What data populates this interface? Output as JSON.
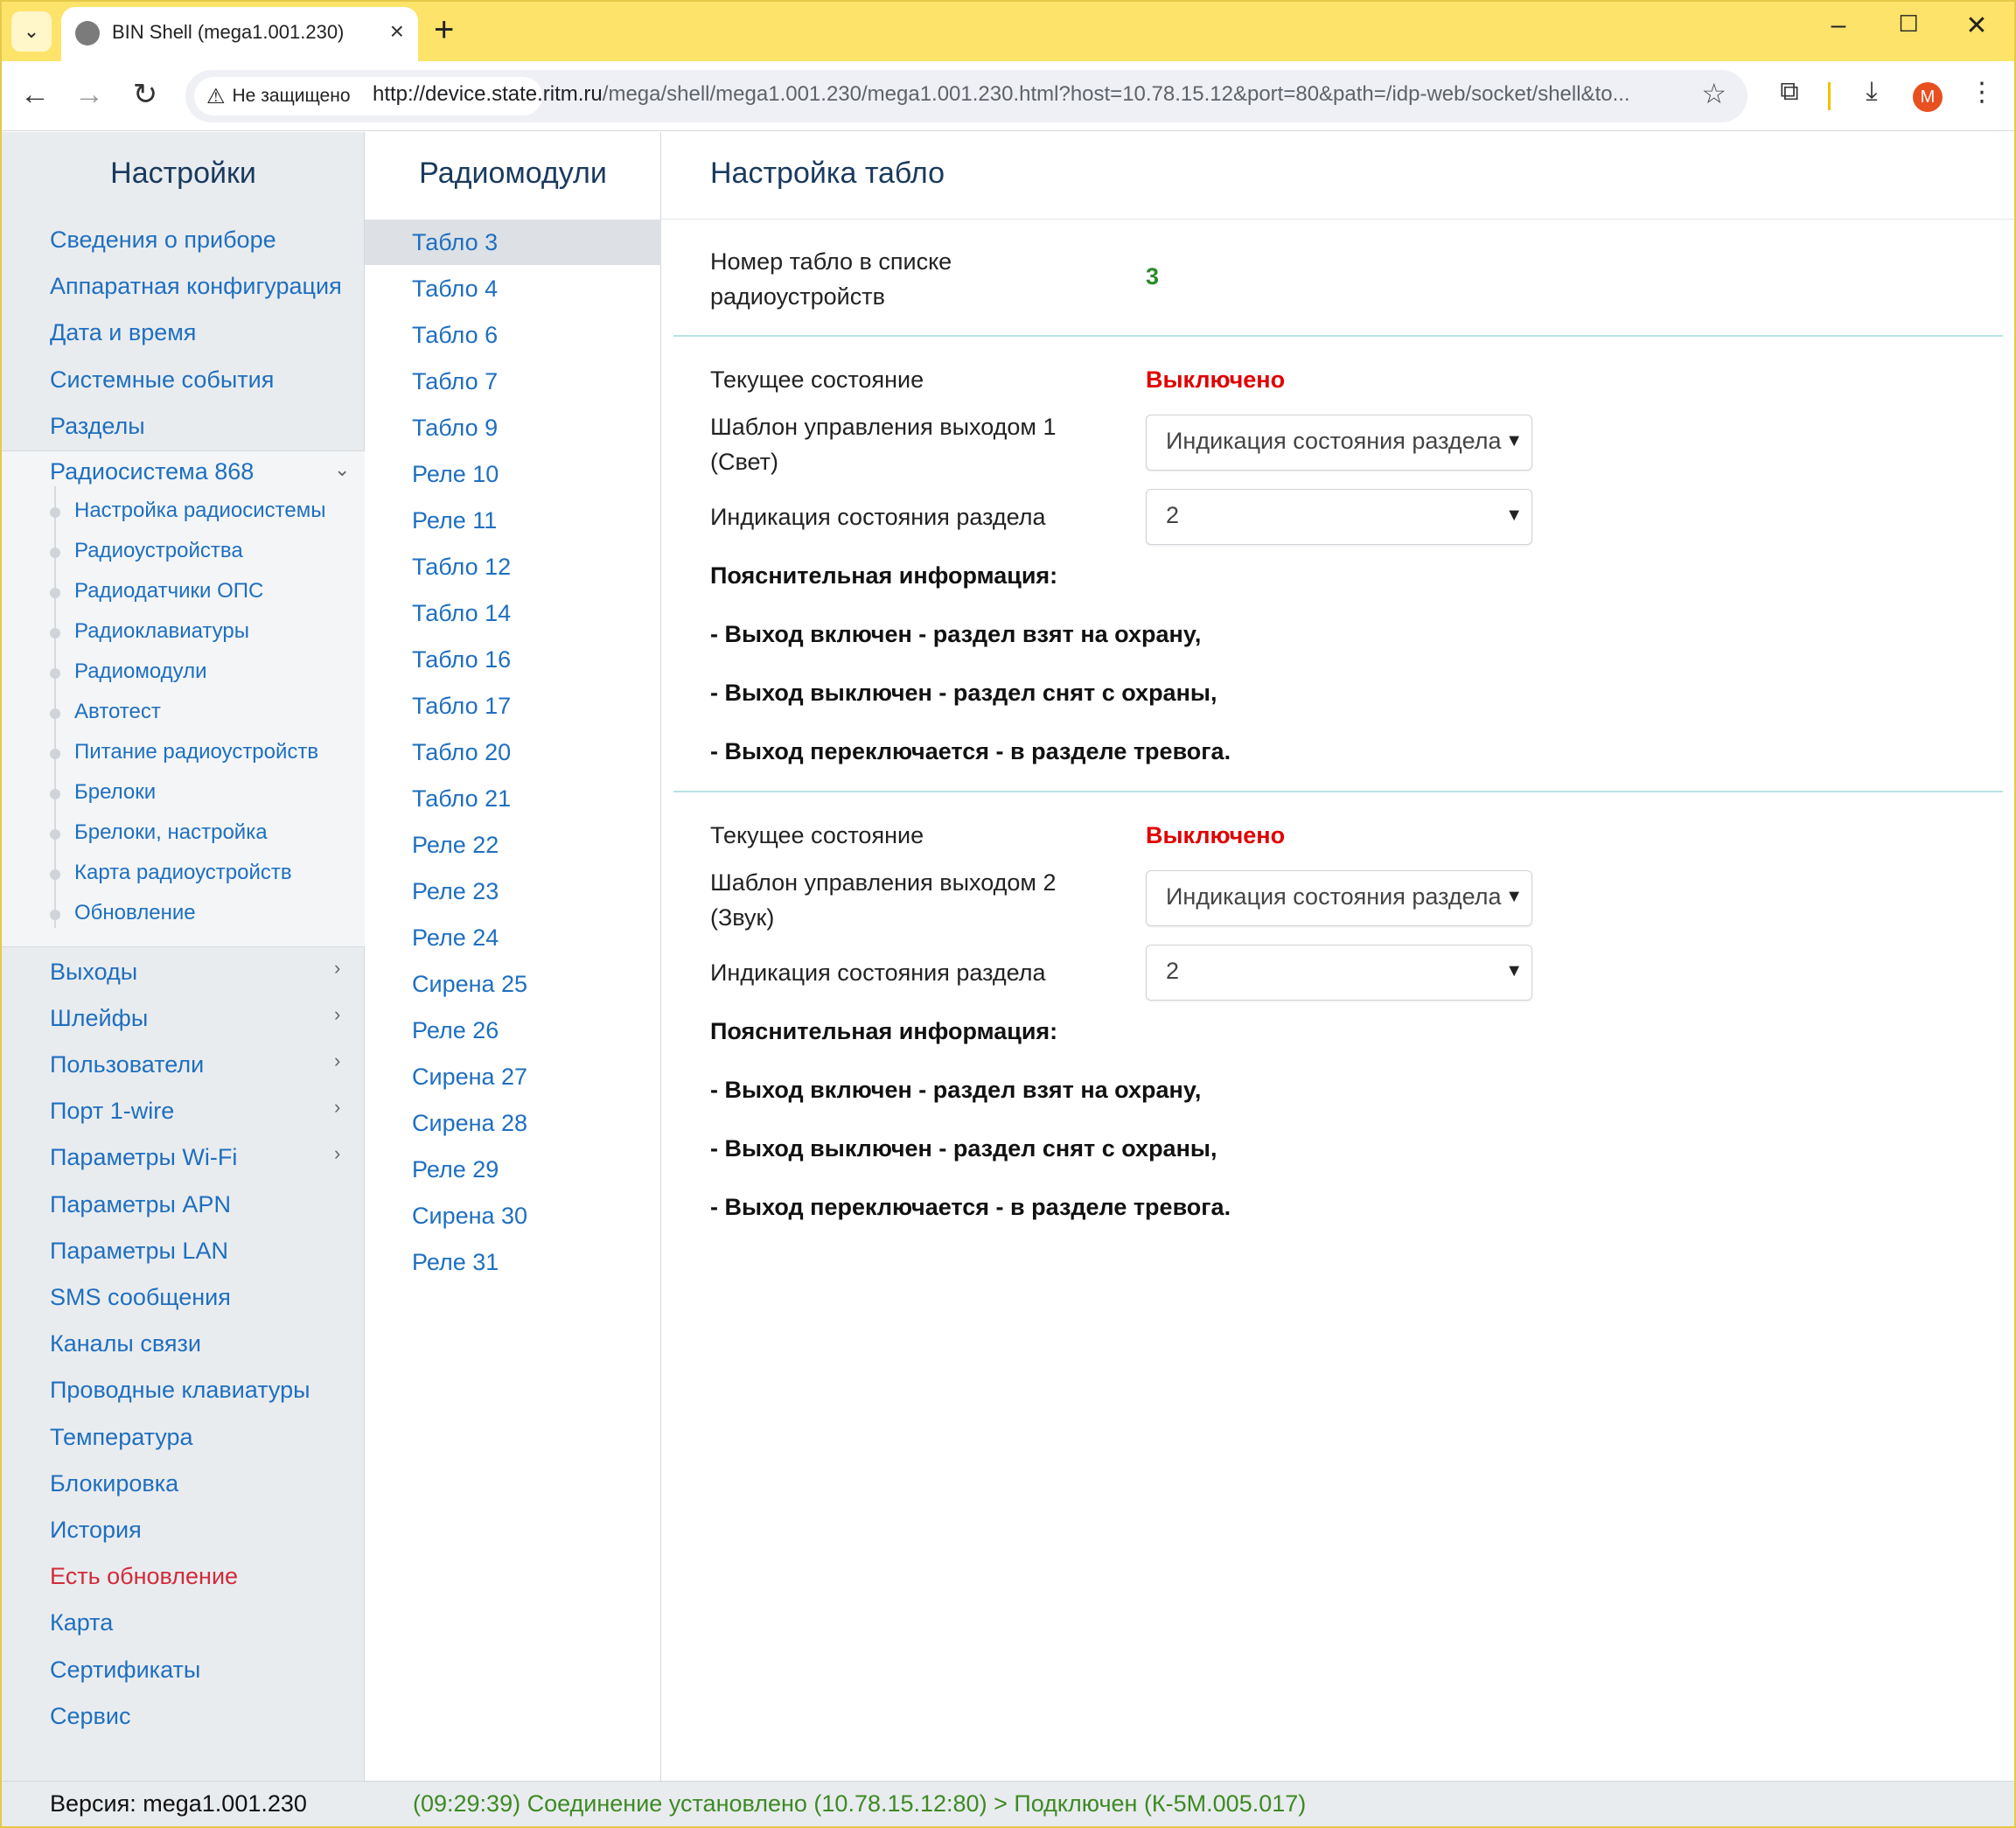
{
  "browser": {
    "tab_title": "BIN Shell (mega1.001.230)",
    "security_label": "Не защищено",
    "url_host": "http://device.state.ritm.ru",
    "url_rest": "/mega/shell/mega1.001.230/mega1.001.230.html?host=10.78.15.12&port=80&path=/idp-web/socket/shell&to...",
    "profile_initial": "M",
    "icons": {
      "tab_list": "chevron-down-icon",
      "tab_favicon": "globe-icon",
      "tab_close": "close-icon",
      "new_tab": "plus-icon",
      "minimize": "minimize-icon",
      "maximize": "maximize-icon",
      "close_window": "close-icon",
      "back": "arrow-left-icon",
      "forward": "arrow-right-icon",
      "reload": "reload-icon",
      "warning": "warning-icon",
      "bookmark": "star-icon",
      "extensions": "puzzle-icon",
      "download": "download-icon",
      "menu": "kebab-menu-icon"
    }
  },
  "sidebar": {
    "title": "Настройки",
    "items_top": [
      "Сведения о приборе",
      "Аппаратная конфигурация",
      "Дата и время",
      "Системные события",
      "Разделы"
    ],
    "radio_group": "Радиосистема 868",
    "radio_sub": [
      "Настройка радиосистемы",
      "Радиоустройства",
      "Радиодатчики ОПС",
      "Радиоклавиатуры",
      "Радиомодули",
      "Автотест",
      "Питание радиоустройств",
      "Брелоки",
      "Брелоки, настройка",
      "Карта радиоустройств",
      "Обновление"
    ],
    "items_expandable": [
      "Выходы",
      "Шлейфы",
      "Пользователи",
      "Порт 1-wire",
      "Параметры Wi-Fi"
    ],
    "items_bottom": [
      "Параметры APN",
      "Параметры LAN",
      "SMS сообщения",
      "Каналы связи",
      "Проводные клавиатуры",
      "Температура",
      "Блокировка",
      "История",
      "Есть обновление",
      "Карта",
      "Сертификаты",
      "Сервис"
    ],
    "alert_color": "#d12b3b",
    "link_color": "#1f6fbf"
  },
  "modules": {
    "title": "Радиомодули",
    "active_index": 0,
    "items": [
      "Табло 3",
      "Табло 4",
      "Табло 6",
      "Табло 7",
      "Табло 9",
      "Реле 10",
      "Реле 11",
      "Табло 12",
      "Табло 14",
      "Табло 16",
      "Табло 17",
      "Табло 20",
      "Табло 21",
      "Реле 22",
      "Реле 23",
      "Реле 24",
      "Сирена 25",
      "Реле 26",
      "Сирена 27",
      "Сирена 28",
      "Реле 29",
      "Сирена 30",
      "Реле 31"
    ]
  },
  "content": {
    "title": "Настройка табло",
    "number_label": "Номер табло в списке радиоустройств",
    "number_value": "3",
    "outputs": [
      {
        "state_label": "Текущее состояние",
        "state_value": "Выключено",
        "template_label": "Шаблон управления выходом 1 (Свет)",
        "template_value": "Индикация состояния раздела",
        "partition_label": "Индикация состояния раздела",
        "partition_value": "2",
        "info_title": "Пояснительная информация:",
        "info_lines": [
          "- Выход включен - раздел взят на охрану,",
          "- Выход выключен - раздел снят с охраны,",
          "- Выход переключается - в разделе тревога."
        ]
      },
      {
        "state_label": "Текущее состояние",
        "state_value": "Выключено",
        "template_label": "Шаблон управления выходом 2 (Звук)",
        "template_value": "Индикация состояния раздела",
        "partition_label": "Индикация состояния раздела",
        "partition_value": "2",
        "info_title": "Пояснительная информация:",
        "info_lines": [
          "- Выход включен - раздел взят на охрану,",
          "- Выход выключен - раздел снят с охраны,",
          "- Выход переключается - в разделе тревога."
        ]
      }
    ]
  },
  "footer": {
    "version": "Версия: mega1.001.230",
    "status": "(09:29:39) Соединение установлено (10.78.15.12:80) > Подключен (К-5М.005.017)"
  }
}
